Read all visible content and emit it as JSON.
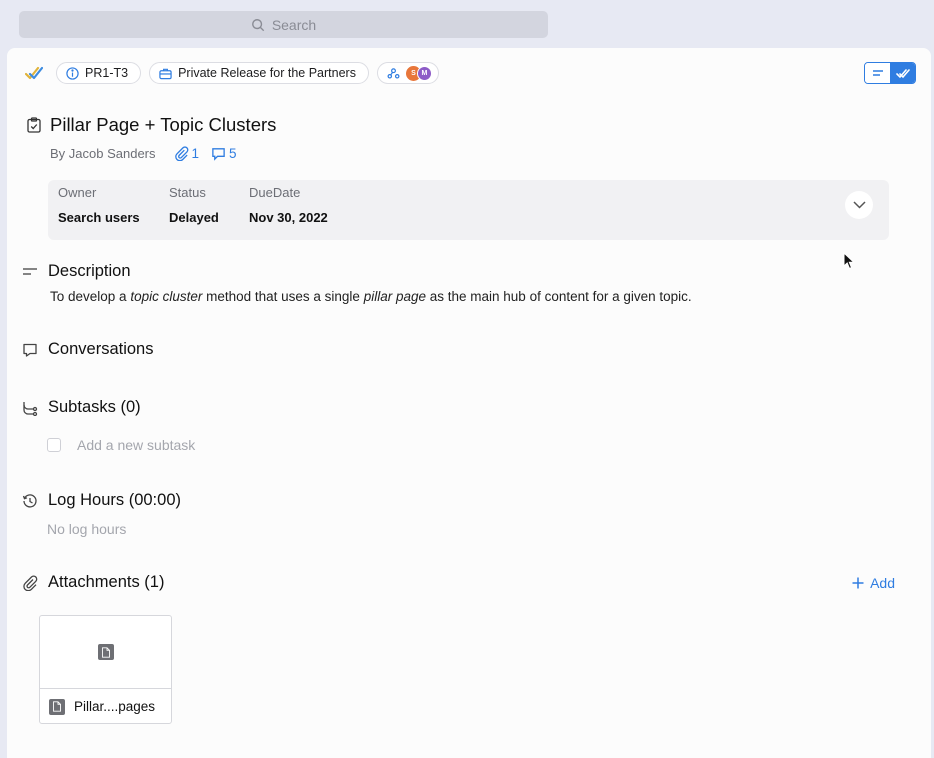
{
  "search": {
    "placeholder": "Search"
  },
  "topbar": {
    "task_id": "PR1-T3",
    "project": "Private Release for the Partners",
    "avatars": [
      "S",
      "M"
    ]
  },
  "task": {
    "title": "Pillar Page + Topic Clusters",
    "author": "By Jacob Sanders",
    "attachments_count": "1",
    "comments_count": "5"
  },
  "fields": {
    "owner_label": "Owner",
    "owner_value": "Search users",
    "status_label": "Status",
    "status_value": "Delayed",
    "due_label": "DueDate",
    "due_value": "Nov 30, 2022"
  },
  "description": {
    "heading": "Description",
    "text_1": "To develop a ",
    "italic_1": "topic cluster",
    "text_2": " method that uses a single ",
    "italic_2": "pillar page",
    "text_3": " as the main hub of content for a given topic."
  },
  "conversations": {
    "heading": "Conversations"
  },
  "subtasks": {
    "heading": "Subtasks (0)",
    "add_placeholder": "Add a new subtask"
  },
  "log_hours": {
    "heading": "Log Hours (00:00)",
    "empty": "No log hours"
  },
  "attachments": {
    "heading": "Attachments (1)",
    "add_label": "Add",
    "files": [
      {
        "name": "Pillar....pages"
      }
    ]
  },
  "colors": {
    "accent": "#2f7de1",
    "avatar_s": "#e8763a",
    "avatar_m": "#8d5bc7"
  }
}
